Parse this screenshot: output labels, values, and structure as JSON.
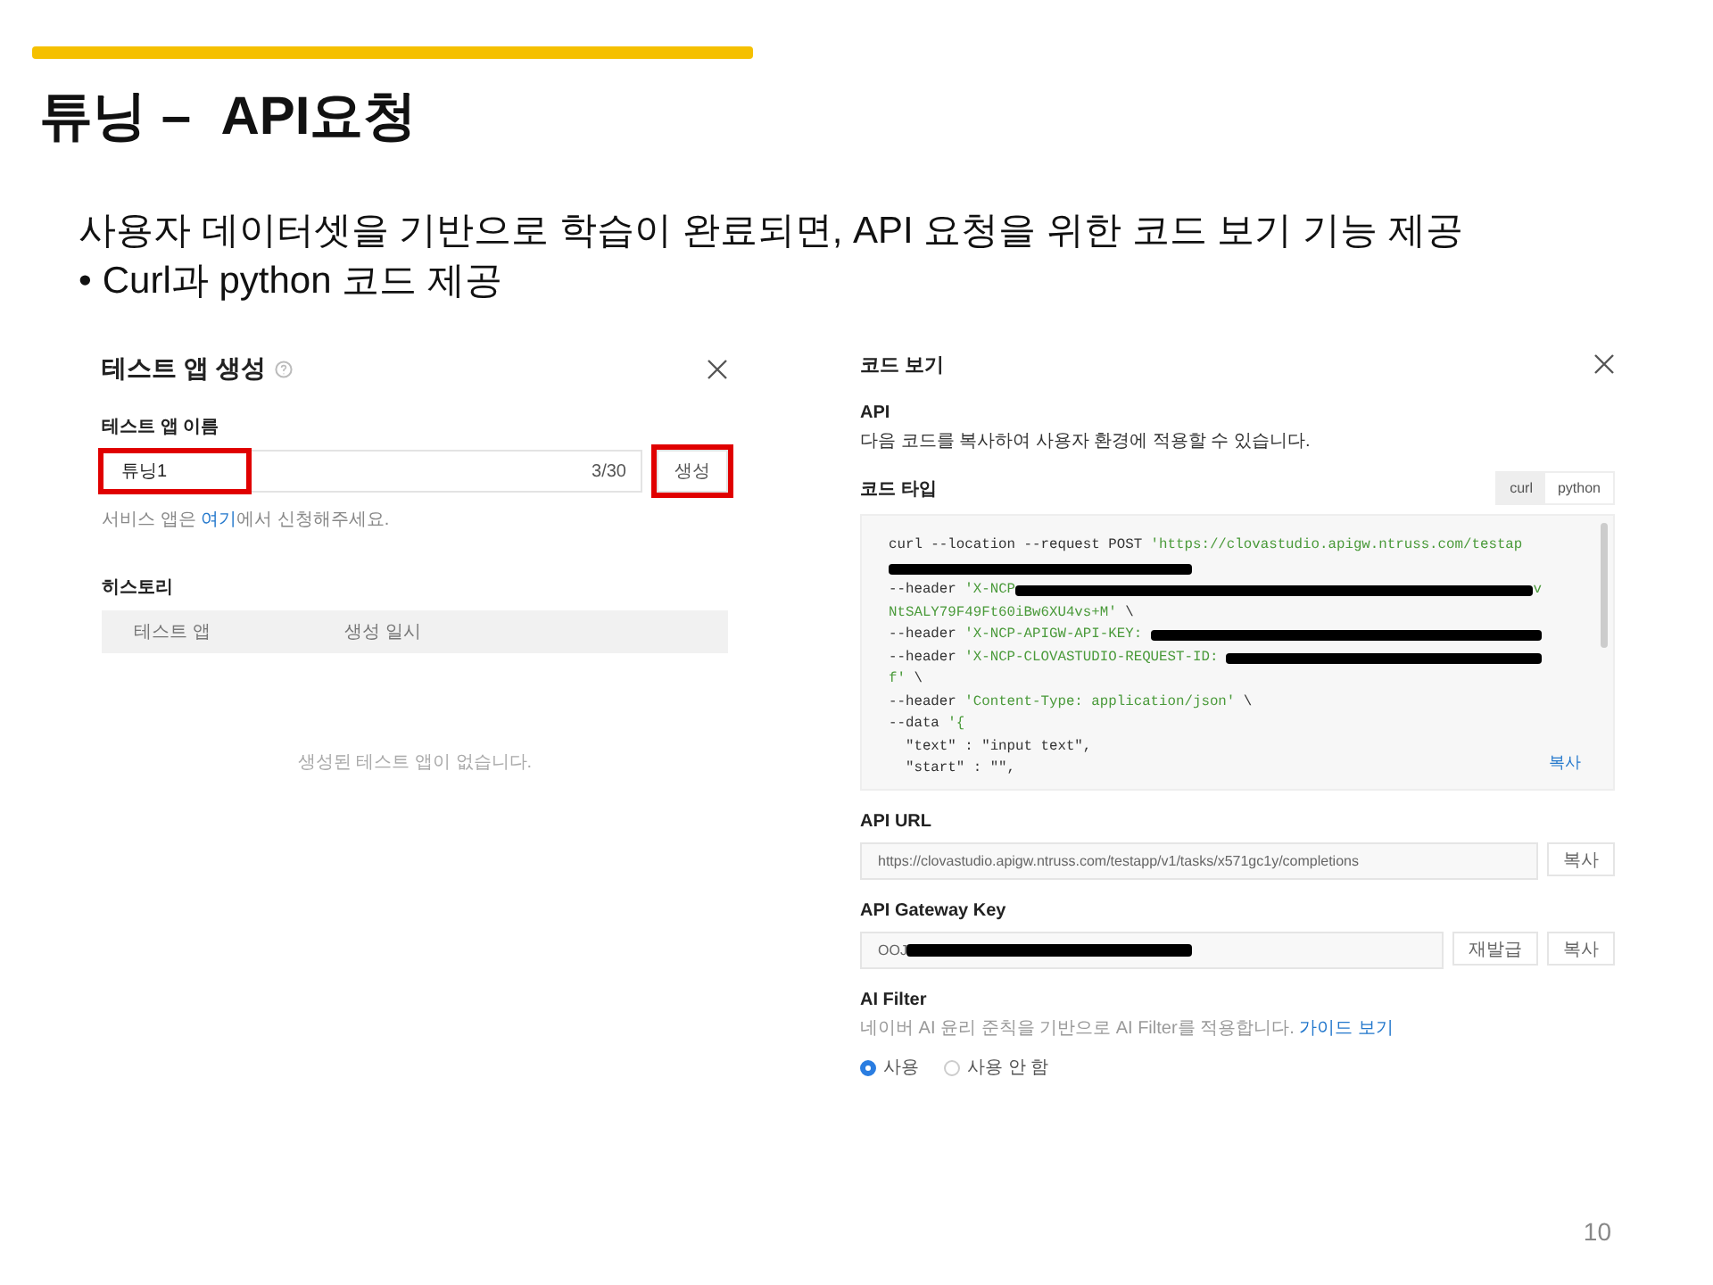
{
  "slide": {
    "title": "튜닝 –  API요청",
    "bullets": [
      {
        "text": "사용자 데이터셋을 기반으로 학습이 완료되면, API 요청을 위한 코드 보기 기능 제공"
      },
      {
        "marker": "•",
        "text": "Curl과 python 코드 제공"
      }
    ],
    "page_number": "10"
  },
  "test_app_dialog": {
    "title": "테스트 앱 생성",
    "name_label": "테스트 앱 이름",
    "name_field": {
      "value": "튜닝1",
      "counter": "3/30",
      "highlighted": true
    },
    "create_button": {
      "label": "생성",
      "highlighted": true
    },
    "hint": {
      "before": "서비스 앱은 ",
      "link": "여기",
      "after": "에서 신청해주세요."
    },
    "history_label": "히스토리",
    "history_columns": [
      "테스트 앱",
      "생성 일시"
    ],
    "empty_message": "생성된 테스트 앱이 없습니다."
  },
  "code_dialog": {
    "title": "코드 보기",
    "api_label": "API",
    "api_description": "다음 코드를 복사하여 사용자 환경에 적용할 수 있습니다.",
    "code_type_label": "코드 타입",
    "code_types": [
      {
        "label": "curl",
        "selected": true
      },
      {
        "label": "python",
        "selected": false
      }
    ],
    "code_lines": [
      [
        {
          "kind": "plain",
          "text": "curl --location --request POST "
        },
        {
          "kind": "string",
          "text": "'https://clovastudio.apigw.ntruss.com/testap"
        }
      ],
      [
        {
          "kind": "redacted"
        }
      ],
      [
        {
          "kind": "plain",
          "text": "--header "
        },
        {
          "kind": "string",
          "text": "'X-NCP"
        },
        {
          "kind": "redacted"
        },
        {
          "kind": "string",
          "text": "v"
        }
      ],
      [
        {
          "kind": "string",
          "text": "NtSALY79F49Ft60iBw6XU4vs+M'"
        },
        {
          "kind": "plain",
          "text": " \\"
        }
      ],
      [
        {
          "kind": "plain",
          "text": "--header "
        },
        {
          "kind": "string",
          "text": "'X-NCP-APIGW-API-KEY: "
        },
        {
          "kind": "redacted"
        }
      ],
      [
        {
          "kind": "plain",
          "text": "--header "
        },
        {
          "kind": "string",
          "text": "'X-NCP-CLOVASTUDIO-REQUEST-ID: "
        },
        {
          "kind": "redacted"
        }
      ],
      [
        {
          "kind": "string",
          "text": "f'"
        },
        {
          "kind": "plain",
          "text": " \\"
        }
      ],
      [
        {
          "kind": "plain",
          "text": "--header "
        },
        {
          "kind": "string",
          "text": "'Content-Type: application/json'"
        },
        {
          "kind": "plain",
          "text": " \\"
        }
      ],
      [
        {
          "kind": "plain",
          "text": "--data "
        },
        {
          "kind": "string",
          "text": "'{"
        }
      ],
      [
        {
          "kind": "plain",
          "text": "  \"text\" : \"input text\","
        }
      ],
      [
        {
          "kind": "plain",
          "text": "  \"start\" : \"\","
        }
      ]
    ],
    "code_copy_link": "복사",
    "api_url_label": "API URL",
    "api_url": "https://clovastudio.apigw.ntruss.com/testapp/v1/tasks/x571gc1y/completions",
    "api_url_copy": "복사",
    "gateway_key_label": "API Gateway Key",
    "gateway_key_prefix": "OOJ",
    "gateway_key_redacted": true,
    "reissue_button": "재발급",
    "gateway_key_copy": "복사",
    "ai_filter_label": "AI Filter",
    "ai_filter_description": {
      "before": "네이버 AI 윤리 준칙을 기반으로 AI Filter를 적용합니다. ",
      "link": "가이드 보기"
    },
    "ai_filter_options": [
      {
        "label": "사용",
        "selected": true
      },
      {
        "label": "사용 안 함",
        "selected": false
      }
    ]
  }
}
